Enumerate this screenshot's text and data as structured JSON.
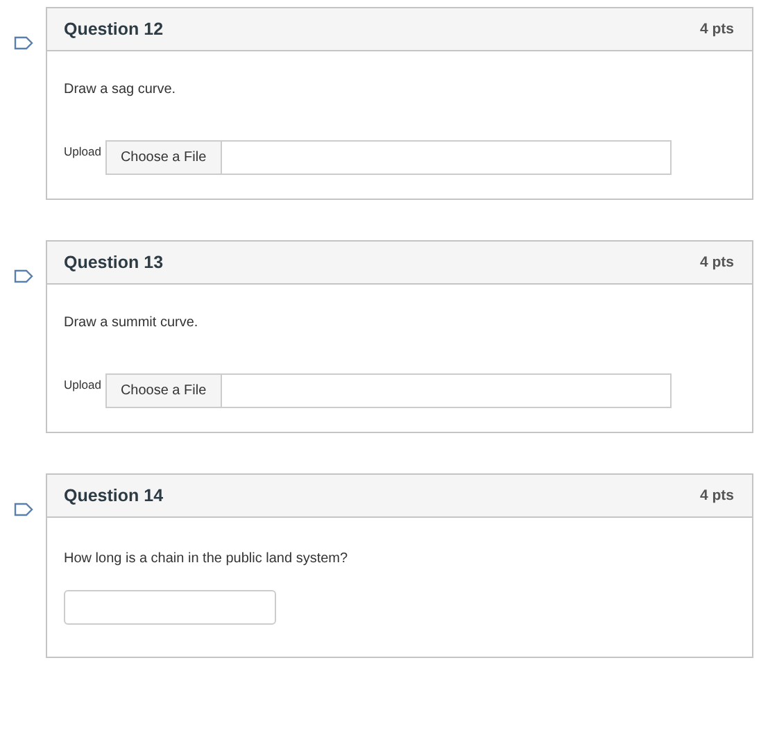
{
  "questions": [
    {
      "title": "Question 12",
      "points": "4 pts",
      "prompt": "Draw a sag curve.",
      "kind": "upload",
      "upload_label": "Upload",
      "button": "Choose a File"
    },
    {
      "title": "Question 13",
      "points": "4 pts",
      "prompt": "Draw a summit curve.",
      "kind": "upload",
      "upload_label": "Upload",
      "button": "Choose a File"
    },
    {
      "title": "Question 14",
      "points": "4 pts",
      "prompt": "How long is a chain in the public land system?",
      "kind": "text"
    }
  ]
}
